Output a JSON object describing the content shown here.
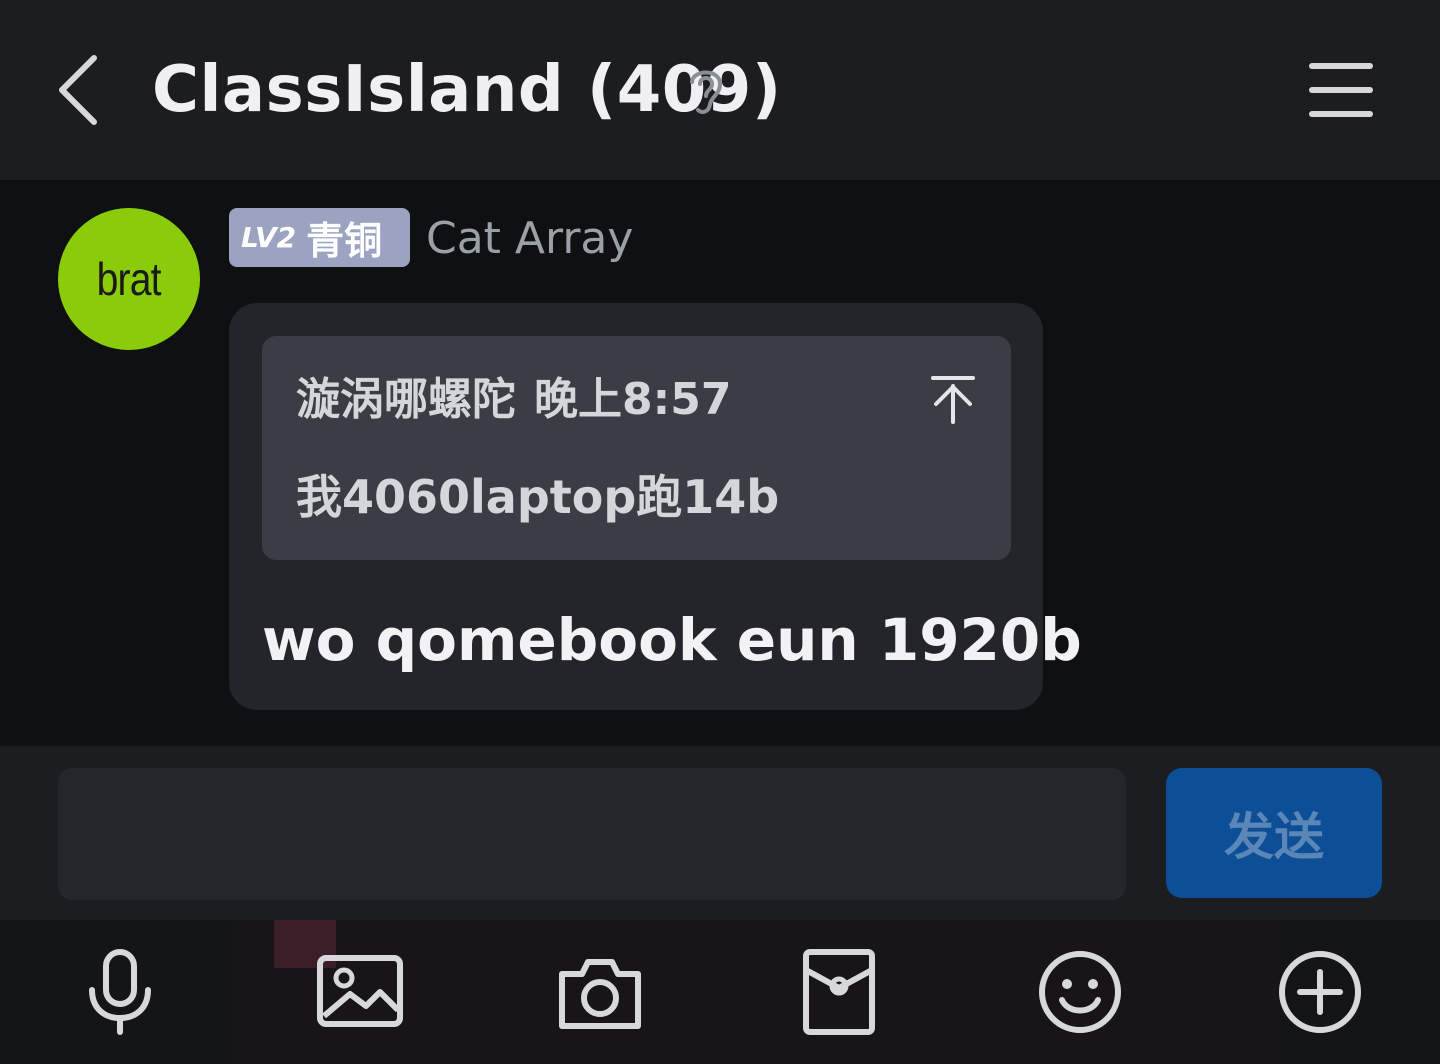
{
  "header": {
    "title": "ClassIsland (409)"
  },
  "message": {
    "avatar_text": "brat",
    "level_badge": "LV2",
    "rank_badge": "青铜",
    "sender": "Cat Array",
    "quote_author": "漩涡哪螺陀",
    "quote_time": "晚上8:57",
    "quote_text": "我4060laptop跑14b",
    "text": "wo qomebook eun 1920b"
  },
  "composer": {
    "input_value": "",
    "send_label": "发送"
  },
  "toolbar": {
    "icons": [
      "microphone-icon",
      "image-icon",
      "camera-icon",
      "red-packet-icon",
      "emoji-icon",
      "plus-icon"
    ]
  },
  "colors": {
    "header_bg": "#1b1d21",
    "bubble_bg": "#23252a",
    "quote_bg": "#3a3d44",
    "avatar_green": "#8acc0a",
    "badge_bg": "#9ba3c1",
    "send_bg": "#0d4f96"
  }
}
